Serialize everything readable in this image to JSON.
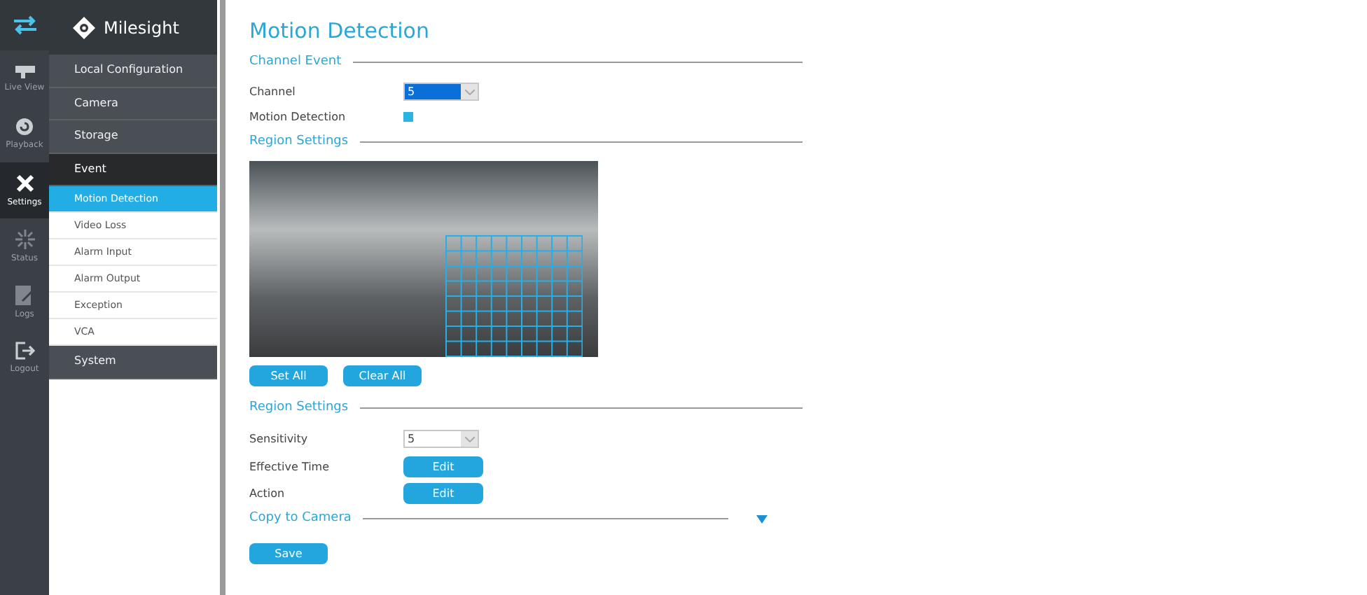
{
  "rail": [
    {
      "kind": "switch"
    },
    {
      "kind": "live",
      "label": "Live View",
      "selected": false
    },
    {
      "kind": "playback",
      "label": "Playback",
      "selected": false
    },
    {
      "kind": "settings",
      "label": "Settings",
      "selected": true
    },
    {
      "kind": "status",
      "label": "Status",
      "selected": false
    },
    {
      "kind": "logs",
      "label": "Logs",
      "selected": false
    },
    {
      "kind": "logout",
      "label": "Logout",
      "selected": false
    }
  ],
  "brand": "Milesight",
  "nav": [
    {
      "label": "Local Configuration",
      "expanded": false
    },
    {
      "label": "Camera",
      "expanded": false
    },
    {
      "label": "Storage",
      "expanded": false
    },
    {
      "label": "Event",
      "expanded": true,
      "children": [
        {
          "label": "Motion Detection",
          "selected": true
        },
        {
          "label": "Video Loss",
          "selected": false
        },
        {
          "label": "Alarm Input",
          "selected": false
        },
        {
          "label": "Alarm Output",
          "selected": false
        },
        {
          "label": "Exception",
          "selected": false
        },
        {
          "label": "VCA",
          "selected": false
        }
      ]
    },
    {
      "label": "System",
      "expanded": false
    }
  ],
  "page_title": "Motion Detection",
  "channel_event": {
    "heading": "Channel Event",
    "channel_label": "Channel",
    "channel_value": "5",
    "motion_label": "Motion Detection",
    "motion_checked": true
  },
  "region": {
    "heading": "Region Settings",
    "buttons": [
      "Set All",
      "Clear All"
    ]
  },
  "settings": {
    "heading": "Region Settings",
    "sensitivity_label": "Sensitivity",
    "sensitivity_value": "5",
    "rows": [
      {
        "label": "Effective Time",
        "button": "Edit"
      },
      {
        "label": "Action",
        "button": "Edit"
      }
    ]
  },
  "copy": {
    "heading": "Copy to Camera",
    "expanded": false
  },
  "save": "Save"
}
